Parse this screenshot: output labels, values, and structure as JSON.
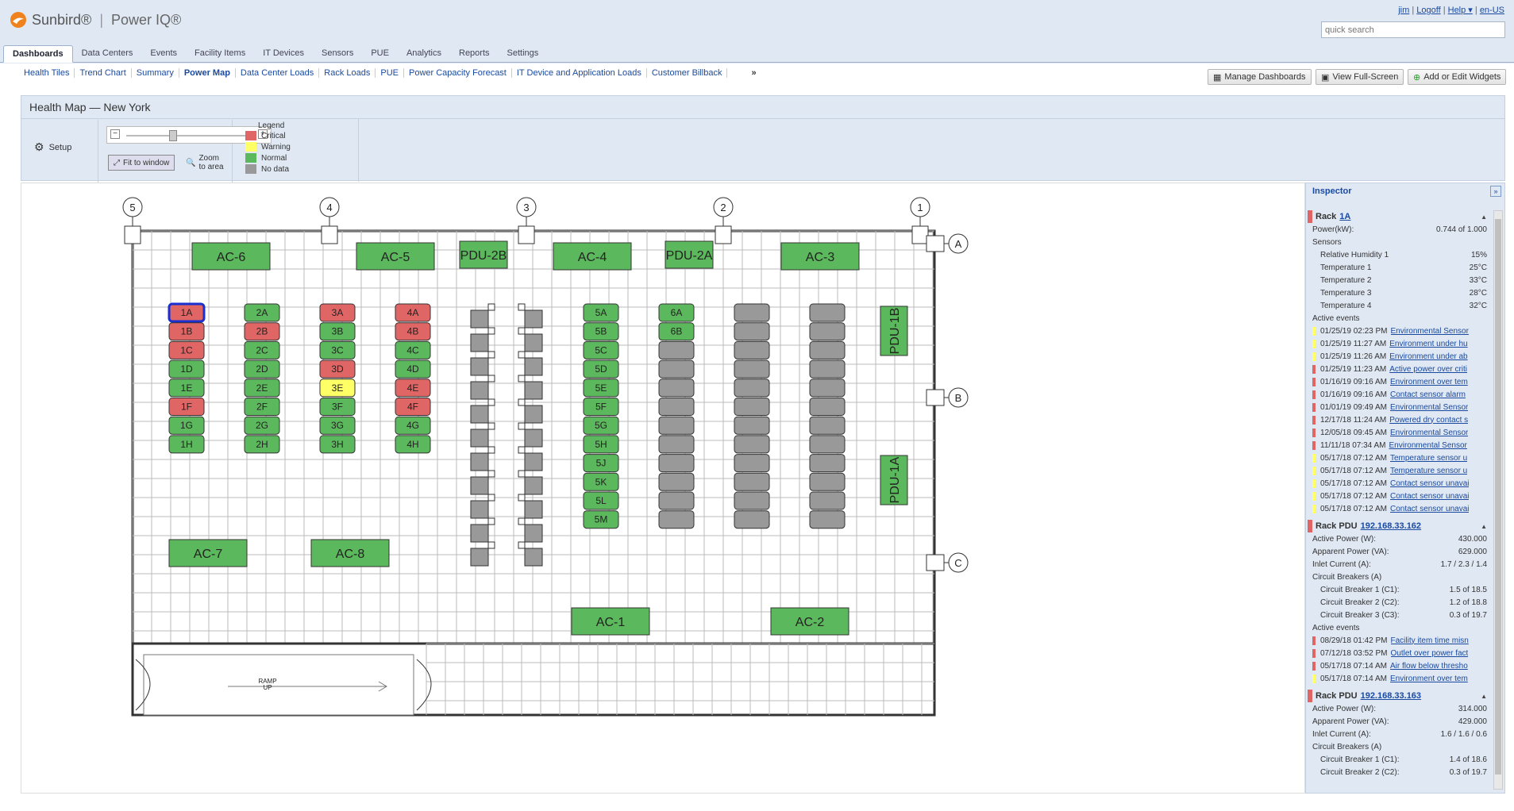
{
  "brand": {
    "name": "Sunbird®",
    "product": "Power IQ®"
  },
  "user": {
    "name": "jim",
    "logoff": "Logoff",
    "help": "Help ▾",
    "locale": "en-US"
  },
  "search": {
    "placeholder": "quick search"
  },
  "tabs": [
    "Dashboards",
    "Data Centers",
    "Events",
    "Facility Items",
    "IT Devices",
    "Sensors",
    "PUE",
    "Analytics",
    "Reports",
    "Settings"
  ],
  "subnav": [
    "Health Tiles",
    "Trend Chart",
    "Summary",
    "Power Map",
    "Data Center Loads",
    "Rack Loads",
    "PUE",
    "Power Capacity Forecast",
    "IT Device and Application Loads",
    "Customer Billback"
  ],
  "subnav_more": "»",
  "buttons": {
    "manage": "Manage Dashboards",
    "fullscreen": "View Full-Screen",
    "widgets": "Add or Edit Widgets"
  },
  "panel": {
    "title": "Health Map — New York",
    "setup": "Setup",
    "fit": "Fit to window",
    "zoom": "Zoom to area"
  },
  "legend": {
    "title": "Legend",
    "items": [
      {
        "label": "Critical",
        "color": "#e06666"
      },
      {
        "label": "Warning",
        "color": "#ffff66"
      },
      {
        "label": "Normal",
        "color": "#5cb85c"
      },
      {
        "label": "No data",
        "color": "#999999"
      }
    ]
  },
  "map": {
    "columns": [
      "5",
      "4",
      "3",
      "2",
      "1"
    ],
    "rows": [
      "A",
      "B",
      "C"
    ],
    "units": [
      "AC-6",
      "AC-5",
      "PDU-2B",
      "AC-4",
      "PDU-2A",
      "AC-3",
      "AC-7",
      "AC-8",
      "AC-1",
      "AC-2",
      "PDU-1B",
      "PDU-1A"
    ],
    "ramp": "RAMP\nUP",
    "racks": [
      {
        "col": 0,
        "items": [
          [
            "1A",
            "crit"
          ],
          [
            "1B",
            "crit"
          ],
          [
            "1C",
            "crit"
          ],
          [
            "1D",
            "norm"
          ],
          [
            "1E",
            "norm"
          ],
          [
            "1F",
            "crit"
          ],
          [
            "1G",
            "norm"
          ],
          [
            "1H",
            "norm"
          ]
        ]
      },
      {
        "col": 1,
        "items": [
          [
            "2A",
            "norm"
          ],
          [
            "2B",
            "crit"
          ],
          [
            "2C",
            "norm"
          ],
          [
            "2D",
            "norm"
          ],
          [
            "2E",
            "norm"
          ],
          [
            "2F",
            "norm"
          ],
          [
            "2G",
            "norm"
          ],
          [
            "2H",
            "norm"
          ]
        ]
      },
      {
        "col": 2,
        "items": [
          [
            "3A",
            "crit"
          ],
          [
            "3B",
            "norm"
          ],
          [
            "3C",
            "norm"
          ],
          [
            "3D",
            "crit"
          ],
          [
            "3E",
            "warn"
          ],
          [
            "3F",
            "norm"
          ],
          [
            "3G",
            "norm"
          ],
          [
            "3H",
            "norm"
          ]
        ]
      },
      {
        "col": 3,
        "items": [
          [
            "4A",
            "crit"
          ],
          [
            "4B",
            "crit"
          ],
          [
            "4C",
            "norm"
          ],
          [
            "4D",
            "norm"
          ],
          [
            "4E",
            "crit"
          ],
          [
            "4F",
            "crit"
          ],
          [
            "4G",
            "norm"
          ],
          [
            "4H",
            "norm"
          ]
        ]
      },
      {
        "col": 4,
        "items": [
          [
            "5A",
            "norm"
          ],
          [
            "5B",
            "norm"
          ],
          [
            "5C",
            "norm"
          ],
          [
            "5D",
            "norm"
          ],
          [
            "5E",
            "norm"
          ],
          [
            "5F",
            "norm"
          ],
          [
            "5G",
            "norm"
          ],
          [
            "5H",
            "norm"
          ],
          [
            "5J",
            "norm"
          ],
          [
            "5K",
            "norm"
          ],
          [
            "5L",
            "norm"
          ],
          [
            "5M",
            "norm"
          ]
        ]
      },
      {
        "col": 5,
        "items": [
          [
            "6A",
            "norm"
          ],
          [
            "6B",
            "norm"
          ],
          [
            "",
            "none"
          ],
          [
            "",
            "none"
          ],
          [
            "",
            "none"
          ],
          [
            "",
            "none"
          ],
          [
            "",
            "none"
          ],
          [
            "",
            "none"
          ],
          [
            "",
            "none"
          ],
          [
            "",
            "none"
          ],
          [
            "",
            "none"
          ],
          [
            "",
            "none"
          ]
        ]
      }
    ]
  },
  "inspector": {
    "title": "Inspector",
    "rack": {
      "label": "Rack",
      "name": "1A",
      "power_label": "Power(kW):",
      "power": "0.744 of 1.000",
      "sensors_label": "Sensors",
      "sensors": [
        [
          "Relative Humidity 1",
          "15%"
        ],
        [
          "Temperature 1",
          "25°C"
        ],
        [
          "Temperature 2",
          "33°C"
        ],
        [
          "Temperature 3",
          "28°C"
        ],
        [
          "Temperature 4",
          "32°C"
        ]
      ],
      "events_label": "Active events",
      "events": [
        [
          "01/25/19 02:23 PM",
          "Environmental Sensor",
          "#ffff66"
        ],
        [
          "01/25/19 11:27 AM",
          "Environment under hu",
          "#ffff66"
        ],
        [
          "01/25/19 11:26 AM",
          "Environment under ab",
          "#ffff66"
        ],
        [
          "01/25/19 11:23 AM",
          "Active power over criti",
          "#e06666"
        ],
        [
          "01/16/19 09:16 AM",
          "Environment over tem",
          "#e06666"
        ],
        [
          "01/16/19 09:16 AM",
          "Contact sensor alarm",
          "#e06666"
        ],
        [
          "01/01/19 09:49 AM",
          "Environmental Sensor",
          "#e06666"
        ],
        [
          "12/17/18 11:24 AM",
          "Powered dry contact s",
          "#e06666"
        ],
        [
          "12/05/18 09:45 AM",
          "Environmental Sensor",
          "#e06666"
        ],
        [
          "11/11/18 07:34 AM",
          "Environmental Sensor",
          "#e06666"
        ],
        [
          "05/17/18 07:12 AM",
          "Temperature sensor u",
          "#ffff66"
        ],
        [
          "05/17/18 07:12 AM",
          "Temperature sensor u",
          "#ffff66"
        ],
        [
          "05/17/18 07:12 AM",
          "Contact sensor unavai",
          "#ffff66"
        ],
        [
          "05/17/18 07:12 AM",
          "Contact sensor unavai",
          "#ffff66"
        ],
        [
          "05/17/18 07:12 AM",
          "Contact sensor unavai",
          "#ffff66"
        ]
      ]
    },
    "pdu1": {
      "label": "Rack PDU",
      "ip": "192.168.33.162",
      "rows": [
        [
          "Active Power (W):",
          "430.000"
        ],
        [
          "Apparent Power (VA):",
          "629.000"
        ],
        [
          "Inlet Current (A):",
          "1.7 / 2.3 / 1.4"
        ]
      ],
      "cb_label": "Circuit Breakers (A)",
      "cbs": [
        [
          "Circuit Breaker 1 (C1):",
          "1.5 of 18.5"
        ],
        [
          "Circuit Breaker 2 (C2):",
          "1.2 of 18.8"
        ],
        [
          "Circuit Breaker 3 (C3):",
          "0.3 of 19.7"
        ]
      ],
      "events_label": "Active events",
      "events": [
        [
          "08/29/18 01:42 PM",
          "Facility item time misn",
          "#e06666"
        ],
        [
          "07/12/18 03:52 PM",
          "Outlet over power fact",
          "#e06666"
        ],
        [
          "05/17/18 07:14 AM",
          "Air flow below thresho",
          "#e06666"
        ],
        [
          "05/17/18 07:14 AM",
          "Environment over tem",
          "#ffff66"
        ]
      ]
    },
    "pdu2": {
      "label": "Rack PDU",
      "ip": "192.168.33.163",
      "rows": [
        [
          "Active Power (W):",
          "314.000"
        ],
        [
          "Apparent Power (VA):",
          "429.000"
        ],
        [
          "Inlet Current (A):",
          "1.6 / 1.6 / 0.6"
        ]
      ],
      "cb_label": "Circuit Breakers (A)",
      "cbs": [
        [
          "Circuit Breaker 1 (C1):",
          "1.4 of 18.6"
        ],
        [
          "Circuit Breaker 2 (C2):",
          "0.3 of 19.7"
        ]
      ]
    }
  },
  "colors": {
    "crit": "#e06666",
    "warn": "#ffff66",
    "norm": "#5cb85c",
    "none": "#999999"
  }
}
